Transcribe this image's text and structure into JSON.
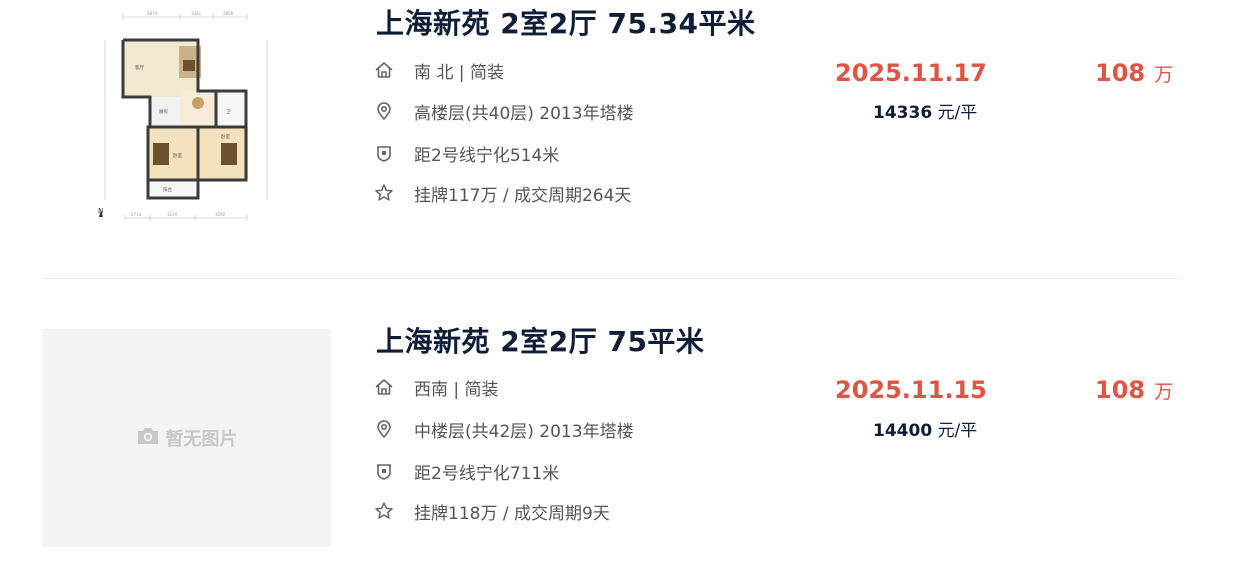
{
  "listings": [
    {
      "title": "上海新苑 2室2厅 75.34平米",
      "image": "floor-plan",
      "orientation_decoration": "南 北 | 简装",
      "floor_year": "高楼层(共40层) 2013年塔楼",
      "subway": "距2号线宁化514米",
      "listing_cycle": "挂牌117万 / 成交周期264天",
      "deal_date": "2025.11.17",
      "unit_price_value": "14336",
      "unit_price_unit": "元/平",
      "total_price": "108",
      "total_unit": "万"
    },
    {
      "title": "上海新苑 2室2厅 75平米",
      "image": "no-image",
      "no_image_text": "暂无图片",
      "orientation_decoration": "西南 | 简装",
      "floor_year": "中楼层(共42层) 2013年塔楼",
      "subway": "距2号线宁化711米",
      "listing_cycle": "挂牌118万 / 成交周期9天",
      "deal_date": "2025.11.15",
      "unit_price_value": "14400",
      "unit_price_unit": "元/平",
      "total_price": "108",
      "total_unit": "万"
    }
  ],
  "icons": {
    "row1": "house-icon",
    "row2": "location-pin-icon",
    "row3": "subway-shield-icon",
    "row4": "star-icon",
    "no_image": "camera-icon"
  },
  "colors": {
    "title": "#101d37",
    "price_red": "#de5544",
    "info_text": "#555555",
    "placeholder_bg": "#f4f4f4"
  }
}
